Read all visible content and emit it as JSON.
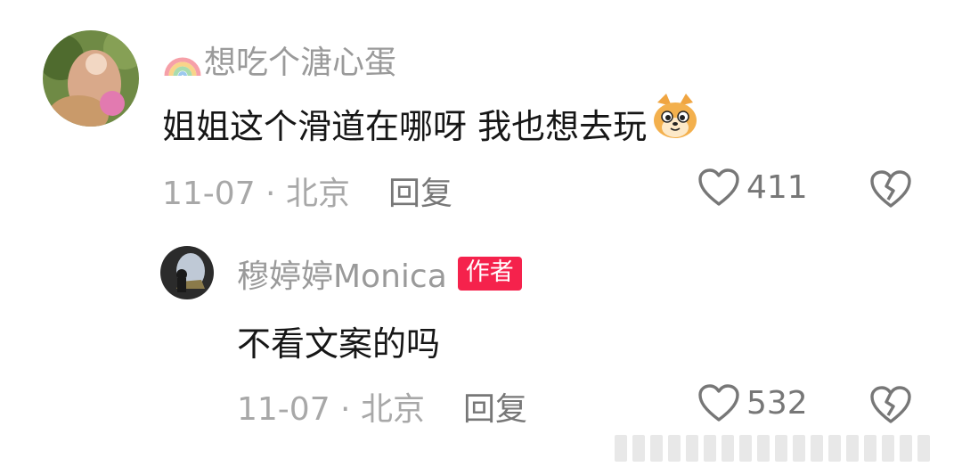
{
  "comments": [
    {
      "username": "想吃个溏心蛋",
      "username_emoji": "rainbow-icon",
      "text": "姐姐这个滑道在哪呀 我也想去玩",
      "text_emoji": "dog-face-icon",
      "meta": "11-07 · 北京",
      "reply_label": "回复",
      "like_count": "411"
    },
    {
      "username": "穆婷婷Monica",
      "badge": "作者",
      "text": "不看文案的吗",
      "meta": "11-07 · 北京",
      "reply_label": "回复",
      "like_count": "532"
    }
  ],
  "colors": {
    "username": "#9a9a9a",
    "text": "#161616",
    "meta": "#a8a8a8",
    "action": "#777777",
    "badge_bg": "#f5224c"
  }
}
